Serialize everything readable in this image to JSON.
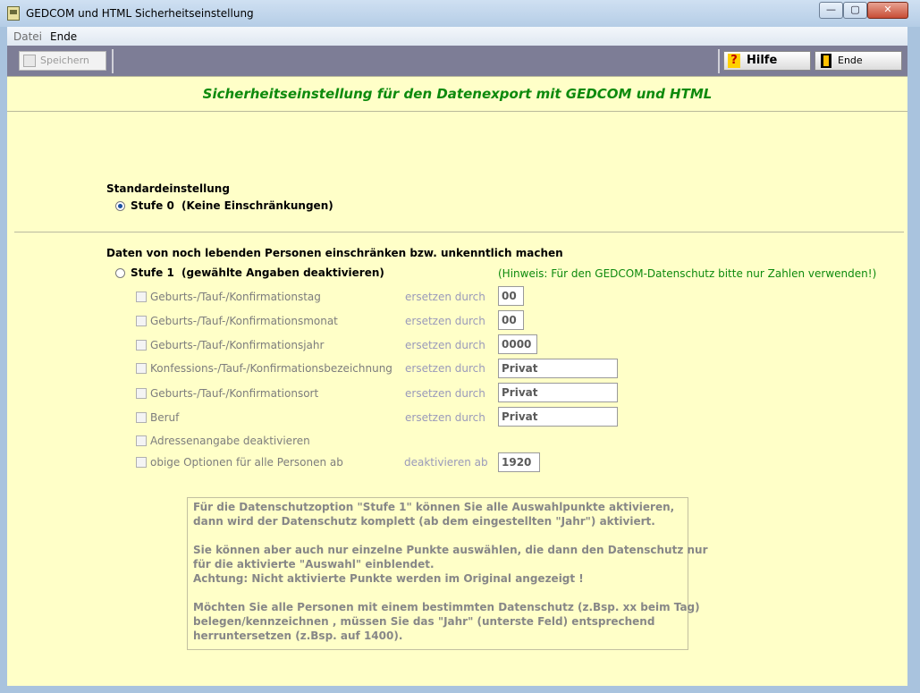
{
  "window": {
    "title": "GEDCOM und HTML Sicherheitseinstellung",
    "min_glyph": "—",
    "max_glyph": "▢",
    "close_glyph": "✕"
  },
  "menu": {
    "datei": "Datei",
    "ende": "Ende"
  },
  "toolbar": {
    "save": "Speichern",
    "help": "Hilfe",
    "exit": "Ende",
    "help_glyph": "?"
  },
  "header": {
    "title": "Sicherheitseinstellung für den Datenexport mit GEDCOM und HTML"
  },
  "standard": {
    "heading": "Standardeinstellung",
    "stufe0_label": "Stufe 0",
    "stufe0_desc": "(Keine Einschränkungen)",
    "stufe0_selected": true
  },
  "restrict": {
    "heading": "Daten von noch lebenden Personen einschränken bzw. unkenntlich machen",
    "stufe1_label": "Stufe 1",
    "stufe1_desc": "(gewählte Angaben deaktivieren)",
    "stufe1_selected": false,
    "hint": "(Hinweis: Für den GEDCOM-Datenschutz bitte nur Zahlen verwenden!)"
  },
  "options": [
    {
      "label": "Geburts-/Tauf-/Konfirmationstag",
      "action": "ersetzen durch",
      "value": "00"
    },
    {
      "label": "Geburts-/Tauf-/Konfirmationsmonat",
      "action": "ersetzen durch",
      "value": "00"
    },
    {
      "label": "Geburts-/Tauf-/Konfirmationsjahr",
      "action": "ersetzen durch",
      "value": "0000"
    },
    {
      "label": "Konfessions-/Tauf-/Konfirmationsbezeichnung",
      "action": "ersetzen durch",
      "value": "Privat"
    },
    {
      "label": "Geburts-/Tauf-/Konfirmationsort",
      "action": "ersetzen durch",
      "value": "Privat"
    },
    {
      "label": "Beruf",
      "action": "ersetzen durch",
      "value": "Privat"
    },
    {
      "label": "Adressenangabe deaktivieren"
    },
    {
      "label": "obige Optionen für alle Personen ab",
      "action": "deaktivieren ab",
      "value": "1920"
    }
  ],
  "info": [
    "Für die Datenschutzoption \"Stufe 1\" können Sie alle Auswahlpunkte aktivieren,",
    "dann wird der Datenschutz komplett (ab dem eingestellten \"Jahr\") aktiviert.",
    "Sie können aber auch nur einzelne Punkte auswählen, die dann den Datenschutz nur",
    "für die aktivierte \"Auswahl\" einblendet.",
    "Achtung: Nicht aktivierte Punkte werden im Original angezeigt !",
    "Möchten Sie alle Personen mit einem bestimmten Datenschutz (z.Bsp. xx beim Tag)",
    "belegen/kennzeichnen , müssen Sie das \"Jahr\" (unterste Feld) entsprechend",
    "herruntersetzen (z.Bsp. auf 1400)."
  ]
}
